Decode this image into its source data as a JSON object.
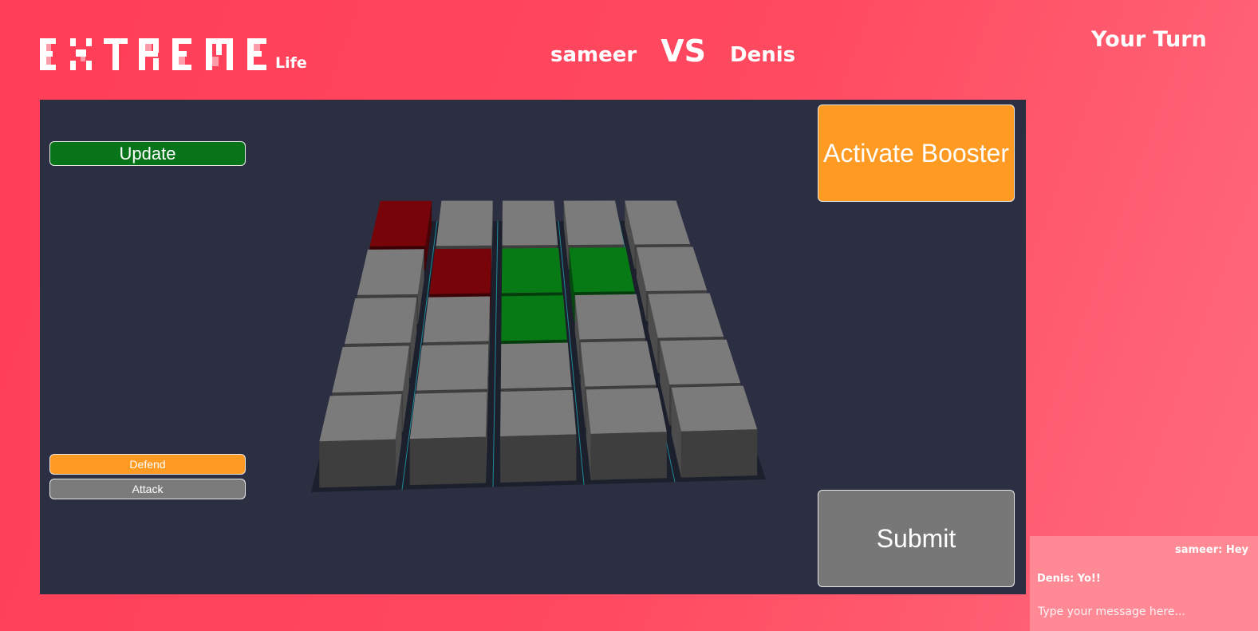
{
  "header": {
    "logo_text": "EXTREME",
    "logo_suffix": "Life",
    "player_left": "sameer",
    "vs_label": "VS",
    "player_right": "Denis",
    "turn_status": "Your Turn"
  },
  "controls": {
    "update_label": "Update",
    "defend_label": "Defend",
    "attack_label": "Attack",
    "booster_label": "Activate Booster",
    "submit_label": "Submit"
  },
  "board": {
    "rows": 5,
    "cols": 5,
    "cells": [
      [
        "red",
        "gray",
        "gray",
        "gray",
        "gray"
      ],
      [
        "gray",
        "red",
        "green",
        "green",
        "gray"
      ],
      [
        "gray",
        "gray",
        "green",
        "gray",
        "gray"
      ],
      [
        "gray",
        "gray",
        "gray",
        "gray",
        "gray"
      ],
      [
        "gray",
        "gray",
        "gray",
        "gray",
        "gray"
      ]
    ],
    "colors": {
      "gray": "#7b7b7b",
      "red": "#760409",
      "green": "#077a16",
      "background": "#2c2f42"
    }
  },
  "chat": {
    "messages": [
      {
        "text": "sameer: Hey"
      },
      {
        "text": "Denis: Yo!!"
      }
    ],
    "placeholder": "Type your message here..."
  },
  "theme": {
    "accent": "#ff4058",
    "orange": "#ff9a22",
    "green": "#08741a"
  }
}
